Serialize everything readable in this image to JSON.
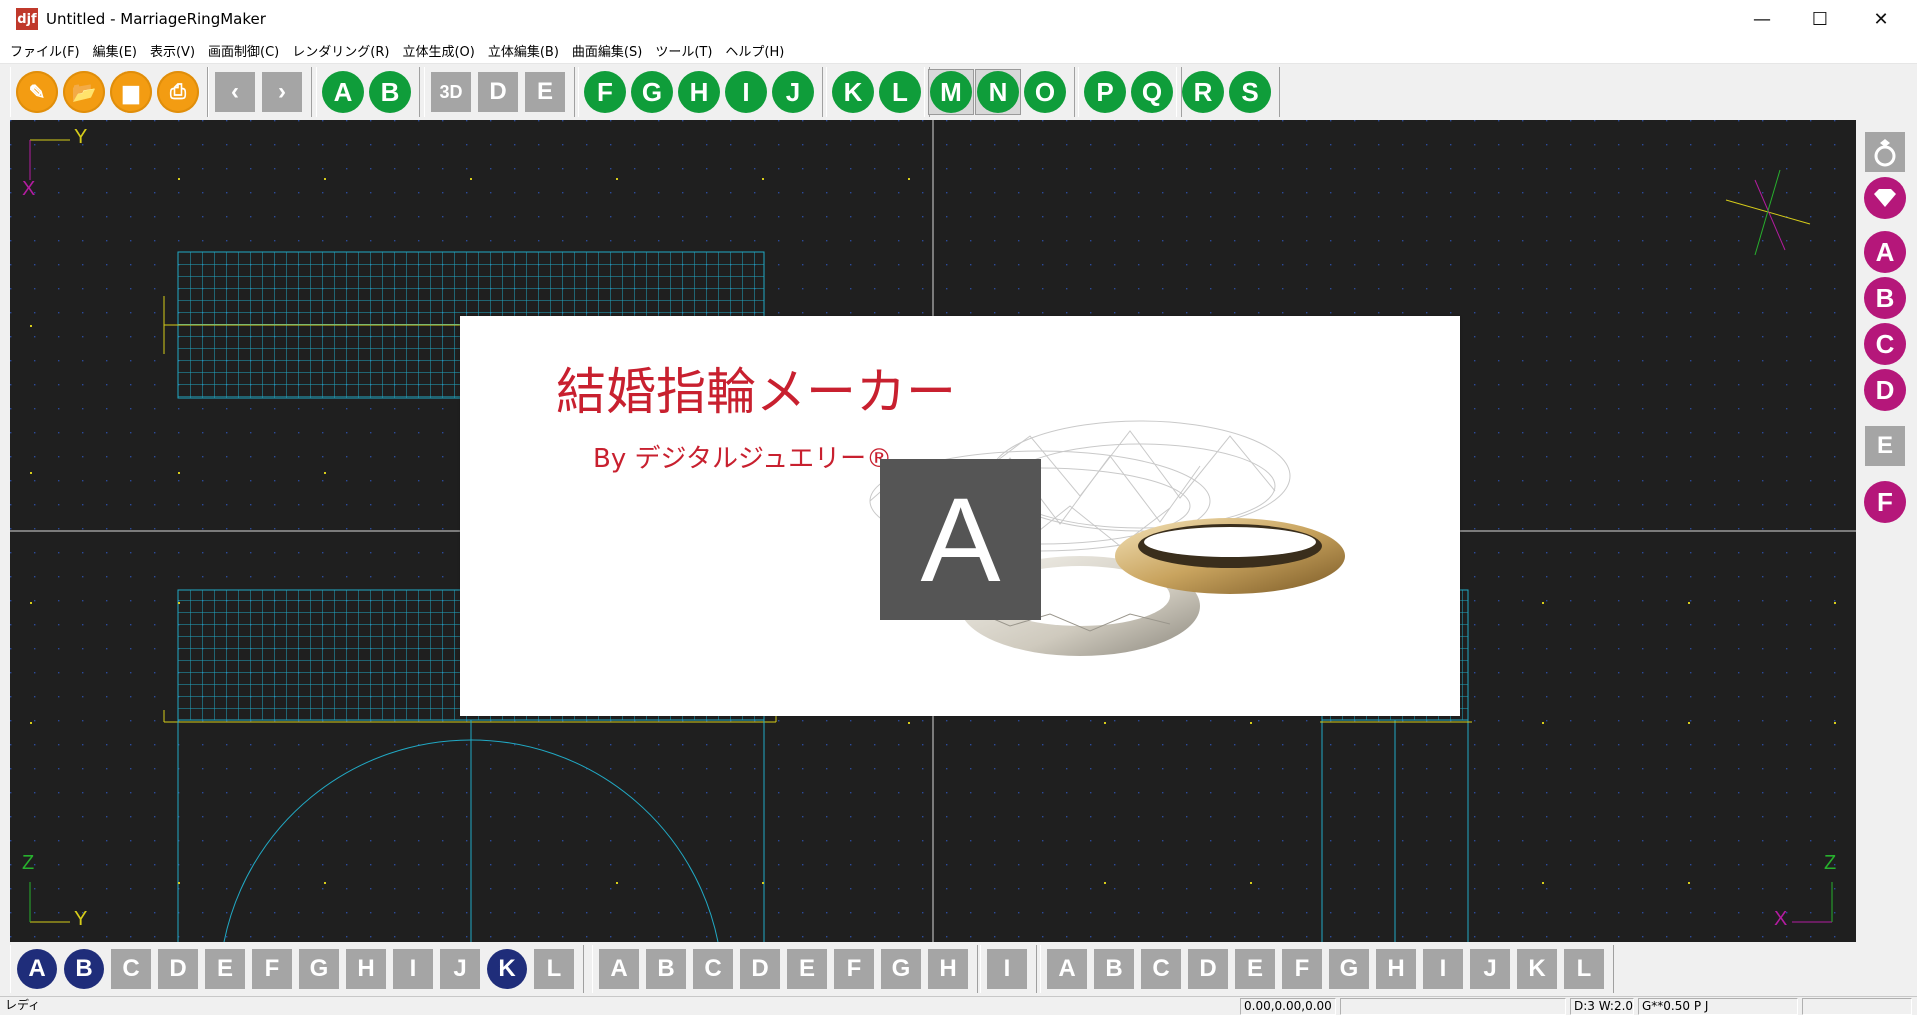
{
  "window": {
    "icon_label": "djf",
    "title": "Untitled - MarriageRingMaker",
    "minimize": "—",
    "maximize": "☐",
    "close": "✕"
  },
  "menu": [
    "ファイル(F)",
    "編集(E)",
    "表示(V)",
    "画面制御(C)",
    "レンダリング(R)",
    "立体生成(O)",
    "立体編集(B)",
    "曲面編集(S)",
    "ツール(T)",
    "ヘルプ(H)"
  ],
  "toolbar": {
    "file_buttons": [
      {
        "name": "new-file-icon",
        "glyph": "✎"
      },
      {
        "name": "open-folder-icon",
        "glyph": "📂"
      },
      {
        "name": "save-icon",
        "glyph": "▆"
      },
      {
        "name": "print-icon",
        "glyph": "⎙"
      }
    ],
    "nav_buttons": [
      "‹",
      "›"
    ],
    "view_group1": [
      "A",
      "B"
    ],
    "view_group2": [
      "3D",
      "D",
      "E"
    ],
    "view_group3": [
      "F",
      "G",
      "H",
      "I",
      "J"
    ],
    "view_group4": [
      "K",
      "L"
    ],
    "view_group5": [
      "M",
      "N",
      "O"
    ],
    "view_group6": [
      "P",
      "Q"
    ],
    "view_group7": [
      "R",
      "S"
    ]
  },
  "viewports": {
    "top_left": {
      "axis_v": "Y",
      "axis_h": "X"
    },
    "bottom_left": {
      "axis_v": "Z",
      "axis_h": "Y"
    },
    "bottom_right": {
      "axis_v": "Z",
      "axis_h": "X"
    }
  },
  "righttool": {
    "icon_buttons": [
      "ring-icon",
      "gem-icon"
    ],
    "group1": [
      "A",
      "B",
      "C",
      "D"
    ],
    "group2": [
      "E"
    ],
    "group3": [
      "F"
    ]
  },
  "bottomtool": {
    "group1": [
      "A",
      "B",
      "C",
      "D",
      "E",
      "F",
      "G",
      "H",
      "I",
      "J",
      "K",
      "L"
    ],
    "group1_active": [
      "A",
      "B",
      "K"
    ],
    "group2": [
      "A",
      "B",
      "C",
      "D",
      "E",
      "F",
      "G",
      "H"
    ],
    "group3": [
      "I"
    ],
    "group4": [
      "A",
      "B",
      "C",
      "D",
      "E",
      "F",
      "G",
      "H",
      "I",
      "J",
      "K",
      "L"
    ]
  },
  "statusbar": {
    "ready": "レディ",
    "coords": "0.00,0.00,0.00",
    "mode": "D:3 W:2.0",
    "grid": "G**0.50 P J"
  },
  "splash": {
    "title": "結婚指輪メーカー",
    "subtitle": "By デジタルジュエリー®",
    "badge": "A"
  },
  "colors": {
    "green_button": "#0f9d3a",
    "orange_button": "#f39c12",
    "magenta_button": "#b5177a",
    "navy_button": "#1f2d7a",
    "gray_button": "#a5a5a5",
    "viewport_bg": "#1f1f1f",
    "grid_cyan": "#21a9c4",
    "guide_yellow": "#d6cc1a",
    "splash_red": "#c8202f"
  }
}
